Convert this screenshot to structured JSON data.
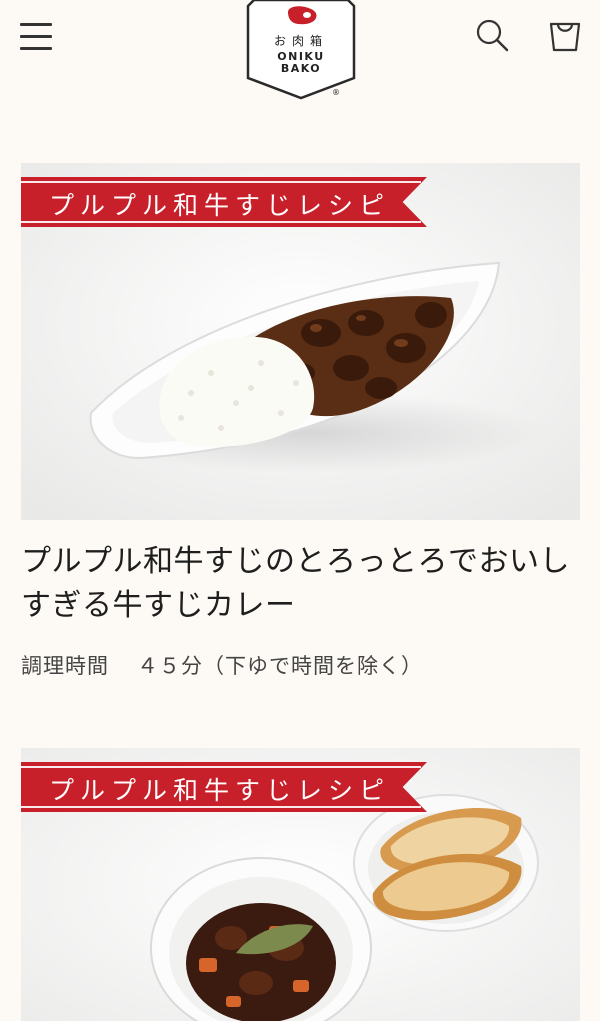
{
  "header": {
    "menu_icon": "hamburger-menu-icon",
    "search_icon": "search-icon",
    "cart_icon": "cart-icon",
    "logo": {
      "kanji": "お肉箱",
      "line1": "ONIKU",
      "line2": "BAKO",
      "registered": "®"
    }
  },
  "recipes": [
    {
      "banner": "プルプル和牛すじレシピ",
      "title": "プルプル和牛すじのとろっとろでおいしすぎる牛すじカレー",
      "time_label": "調理時間",
      "time_value": "４５分（下ゆで時間を除く）"
    },
    {
      "banner": "プルプル和牛すじレシピ"
    }
  ],
  "colors": {
    "background": "#fdf9f4",
    "banner_red": "#c8202a",
    "text": "#1e1e1e"
  }
}
